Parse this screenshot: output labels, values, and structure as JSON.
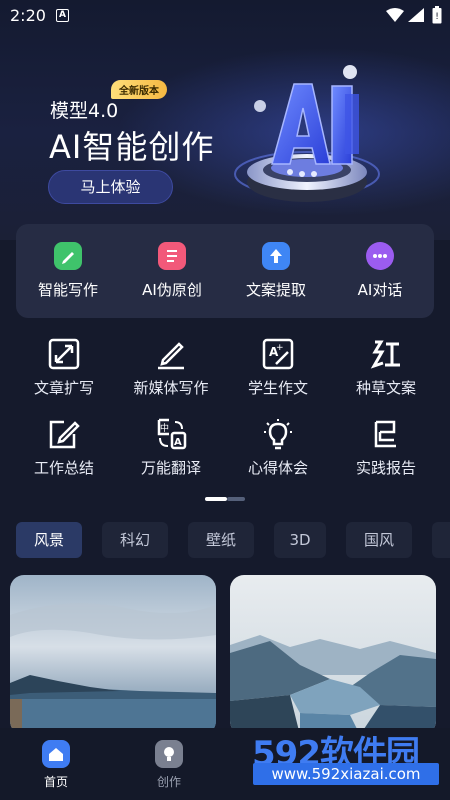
{
  "status_bar": {
    "time": "2:20",
    "notification_icon": "A"
  },
  "banner": {
    "model_label": "模型4.0",
    "badge": "全新版本",
    "title": "AI智能创作",
    "button": "马上体验",
    "hero_icon": "AI-3d-logo"
  },
  "quick_actions": [
    {
      "label": "智能写作",
      "icon": "pen-note-icon",
      "color": "#3fc36b"
    },
    {
      "label": "AI伪原创",
      "icon": "document-icon",
      "color": "#f2597a"
    },
    {
      "label": "文案提取",
      "icon": "upload-arrow-icon",
      "color": "#3f86f5"
    },
    {
      "label": "AI对话",
      "icon": "chat-bubble-icon",
      "color": "#9b5cf0"
    }
  ],
  "tools": [
    {
      "label": "文章扩写",
      "icon": "expand-icon"
    },
    {
      "label": "新媒体写作",
      "icon": "pen-line-icon"
    },
    {
      "label": "学生作文",
      "icon": "edit-a-plus-icon"
    },
    {
      "label": "种草文案",
      "icon": "hong-character-icon"
    },
    {
      "label": "工作总结",
      "icon": "notepad-edit-icon"
    },
    {
      "label": "万能翻译",
      "icon": "translate-icon"
    },
    {
      "label": "心得体会",
      "icon": "lightbulb-icon"
    },
    {
      "label": "实践报告",
      "icon": "flag-report-icon"
    }
  ],
  "pager": {
    "current": 1,
    "total": 2
  },
  "category_tabs": [
    {
      "label": "风景",
      "active": true
    },
    {
      "label": "科幻",
      "active": false
    },
    {
      "label": "壁纸",
      "active": false
    },
    {
      "label": "3D",
      "active": false
    },
    {
      "label": "国风",
      "active": false
    }
  ],
  "cards": [
    {
      "subject": "cloudy-sea-landscape"
    },
    {
      "subject": "snowy-fjord-landscape"
    }
  ],
  "bottom_nav": [
    {
      "label": "首页",
      "icon": "home-icon",
      "active": true
    },
    {
      "label": "创作",
      "icon": "bulb-icon",
      "active": false
    }
  ],
  "watermark": {
    "brand": "592软件园",
    "url": "www.592xiazai.com"
  },
  "colors": {
    "background": "#151a2c",
    "panel": "#262c44",
    "accent": "#3f7cf2",
    "tab_active": "#2b3a66",
    "badge": "#f5b842"
  }
}
